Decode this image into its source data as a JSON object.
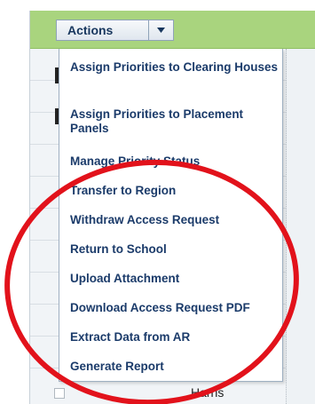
{
  "toolbar": {
    "actions_label": "Actions",
    "dropdown_icon": "triangle-down-icon"
  },
  "menu": {
    "items": [
      {
        "label": "Assign Priorities to Clearing Houses"
      },
      {
        "label": "Assign Priorities to Placement Panels"
      },
      {
        "label": "Manage Priority Status"
      },
      {
        "label": "Transfer to Region"
      },
      {
        "label": "Withdraw Access Request"
      },
      {
        "label": "Return to School"
      },
      {
        "label": "Upload Attachment"
      },
      {
        "label": "Download Access Request PDF"
      },
      {
        "label": "Extract Data from AR"
      },
      {
        "label": "Generate Report"
      }
    ]
  },
  "table": {
    "visible_cell": "Harris"
  },
  "colors": {
    "toolbar_green": "#a9d47e",
    "menu_text": "#1b3b6a",
    "annotation_red": "#e2121b"
  }
}
